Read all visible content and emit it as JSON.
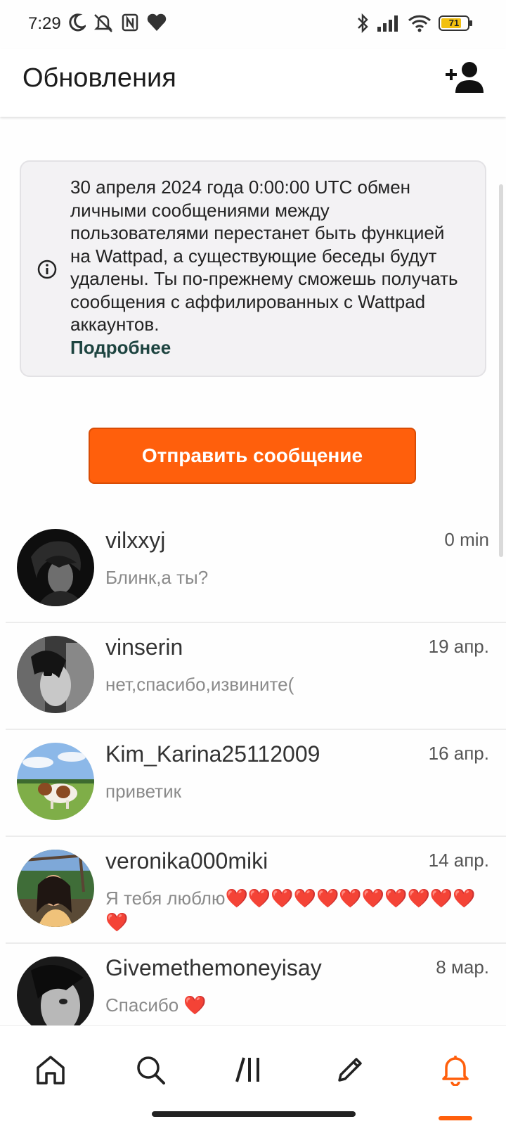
{
  "status_bar": {
    "time": "7:29",
    "battery": "71",
    "left_icons": [
      "moon-icon",
      "mute-icon",
      "nfc-icon",
      "heart-icon"
    ],
    "right_icons": [
      "bluetooth-icon",
      "signal-icon",
      "wifi-icon",
      "battery-icon"
    ]
  },
  "header": {
    "title": "Обновления"
  },
  "notice": {
    "text": "30 апреля 2024 года 0:00:00 UTC обмен личными сообщениями между пользователями перестанет быть функцией на Wattpad, а существующие беседы будут удалены. Ты по-прежнему сможешь получать сообщения с аффилированных с Wattpad аккаунтов.",
    "link": "Подробнее"
  },
  "send_button": {
    "label": "Отправить сообщение"
  },
  "conversations": [
    {
      "name": "vilxxyj",
      "message": "Блинк,а ты?",
      "time": "0 min"
    },
    {
      "name": "vinserin",
      "message": "нет,спасибо,извините(",
      "time": "19 апр."
    },
    {
      "name": "Kim_Karina25112009",
      "message": "приветик",
      "time": "16 апр."
    },
    {
      "name": "veronika000miki",
      "message": "Я тебя люблю❤️❤️❤️❤️❤️❤️❤️❤️❤️❤️❤️❤️",
      "time": "14 апр."
    },
    {
      "name": "Givemethemoneyisay",
      "message": "Спасибо ❤️",
      "time": "8 мар."
    }
  ],
  "nav": {
    "items": [
      "home-icon",
      "search-icon",
      "library-icon",
      "write-icon",
      "notifications-icon"
    ],
    "active_color": "#ff5f0c"
  },
  "colors": {
    "accent": "#ff5f0c",
    "link": "#1d4440"
  }
}
